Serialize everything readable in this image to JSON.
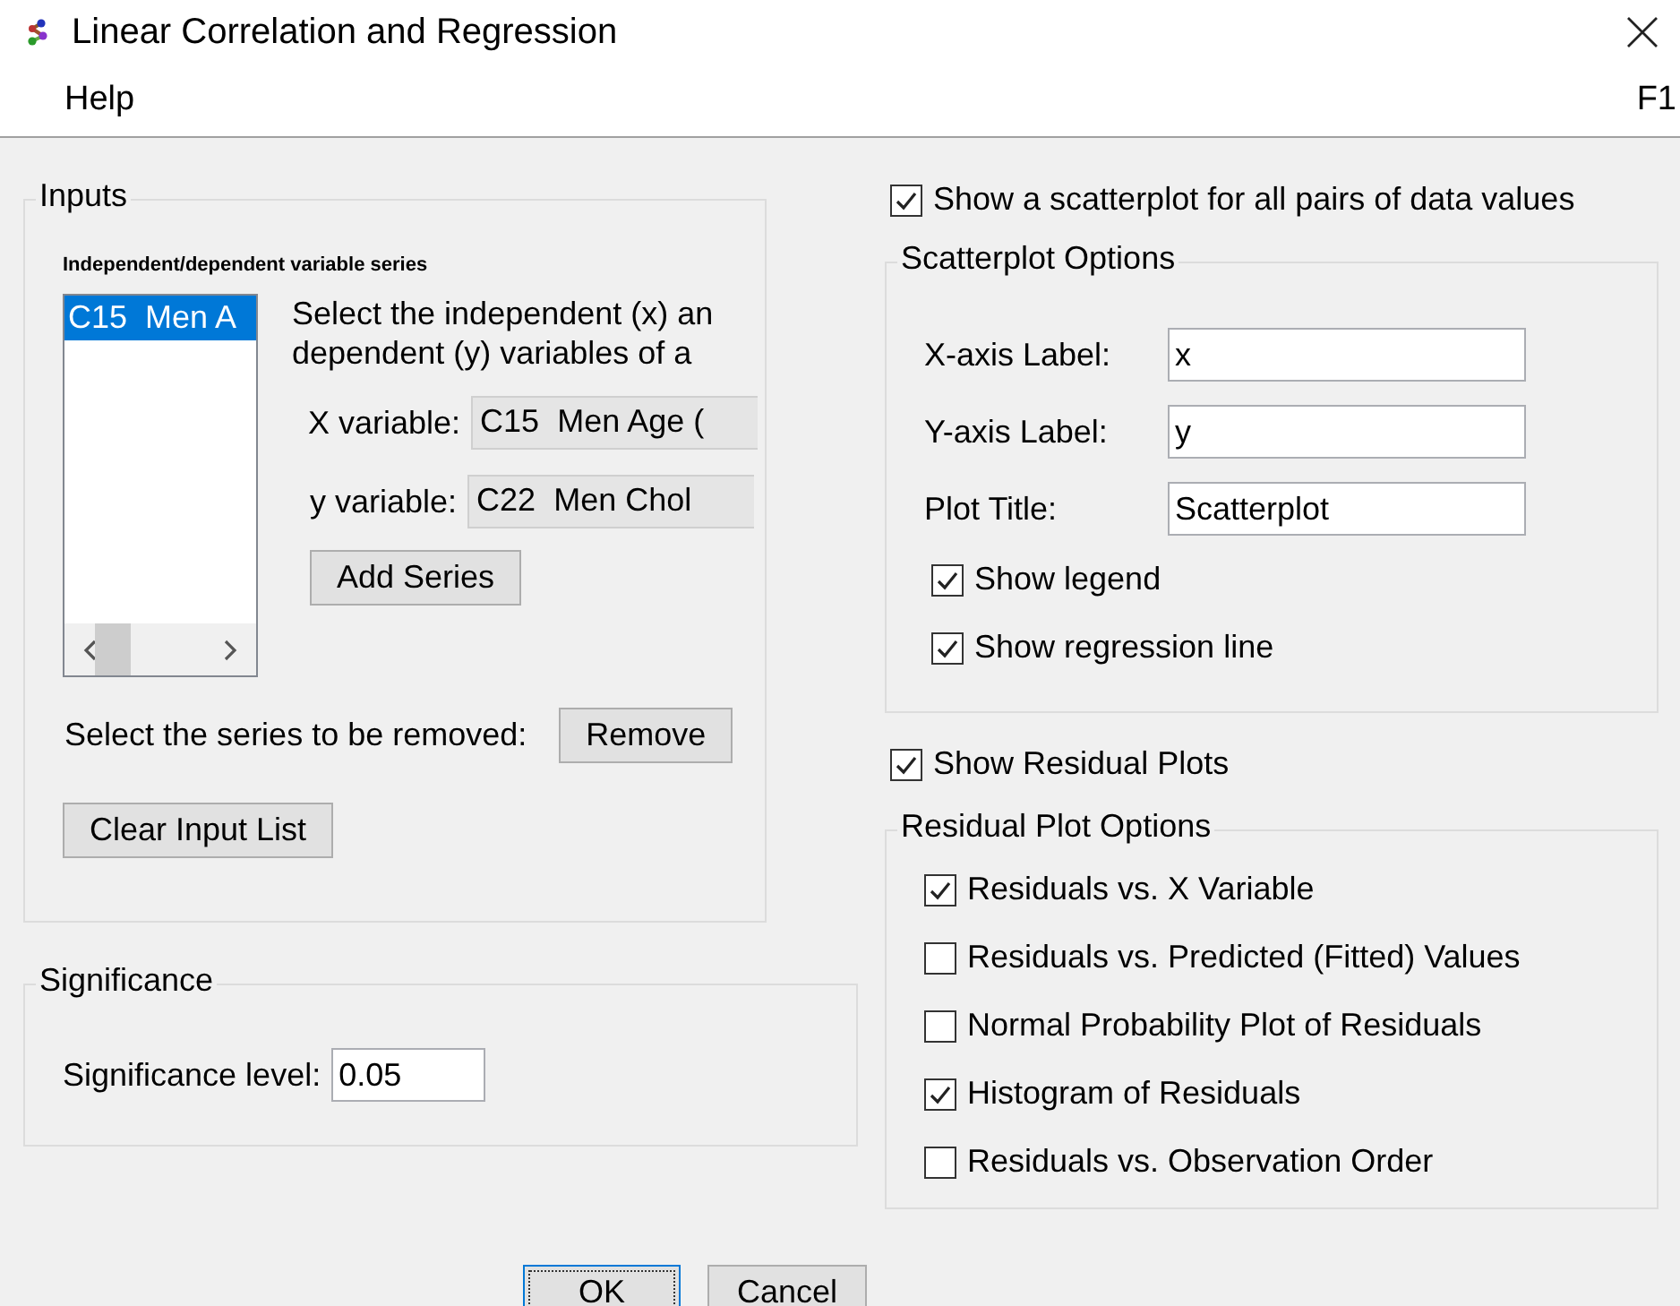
{
  "window": {
    "title": "Linear Correlation and Regression"
  },
  "menu": {
    "items": [
      {
        "label": "Help"
      }
    ],
    "shortcut": "F1"
  },
  "inputs": {
    "title": "Inputs",
    "series_label": "Independent/dependent variable series",
    "series_list": [
      {
        "label": "C15  Men A",
        "selected": true
      }
    ],
    "instructions": [
      "Select the independent (x) an",
      "dependent (y) variables of a"
    ],
    "x_variable": {
      "label": "X variable:",
      "value": "C15  Men Age ("
    },
    "y_variable": {
      "label": "y variable:",
      "value": "C22  Men Chol"
    },
    "add_button": "Add Series",
    "remove_label": "Select the series to be removed:",
    "remove_button": "Remove",
    "clear_button": "Clear Input List"
  },
  "significance": {
    "title": "Significance",
    "label": "Significance level:",
    "value": "0.05"
  },
  "scatterplot": {
    "checkbox": {
      "label": "Show a scatterplot for all pairs of data values",
      "checked": true
    },
    "title": "Scatterplot Options",
    "fields": [
      {
        "label": "X-axis Label:",
        "value": "x"
      },
      {
        "label": "Y-axis Label:",
        "value": "y"
      },
      {
        "label": "Plot Title:",
        "value": "Scatterplot"
      }
    ],
    "options": [
      {
        "label": "Show legend",
        "checked": true
      },
      {
        "label": "Show regression line",
        "checked": true
      }
    ]
  },
  "residuals": {
    "checkbox": {
      "label": "Show Residual Plots",
      "checked": true
    },
    "title": "Residual Plot Options",
    "options": [
      {
        "label": "Residuals vs. X Variable",
        "checked": true
      },
      {
        "label": "Residuals vs. Predicted (Fitted) Values",
        "checked": false
      },
      {
        "label": "Normal Probability Plot of Residuals",
        "checked": false
      },
      {
        "label": "Histogram of Residuals",
        "checked": true
      },
      {
        "label": "Residuals vs. Observation Order",
        "checked": false
      }
    ]
  },
  "buttons": [
    {
      "label": "OK",
      "default": true
    },
    {
      "label": "Cancel",
      "default": false
    }
  ]
}
